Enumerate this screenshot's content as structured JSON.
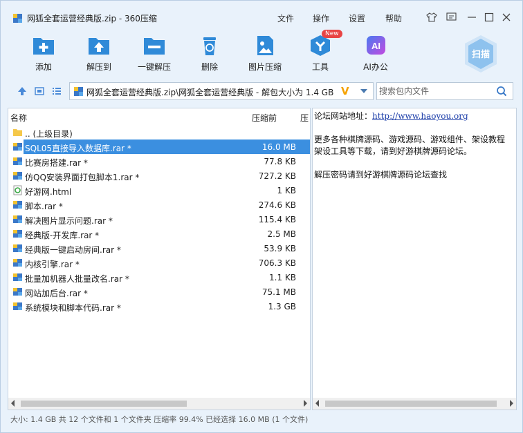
{
  "window": {
    "title": "网狐全套运营经典版.zip - 360压缩",
    "menu": [
      "文件",
      "操作",
      "设置",
      "帮助"
    ]
  },
  "toolbar": {
    "add": "添加",
    "extract_to": "解压到",
    "one_click": "一键解压",
    "delete": "删除",
    "image_compress": "图片压缩",
    "tools": "工具",
    "tools_badge": "New",
    "ai_office": "AI办公",
    "ai_icon": "AI",
    "scan": "扫描"
  },
  "address": {
    "path": "网狐全套运营经典版.zip\\网狐全套运营经典版 - 解包大小为 1.4 GB",
    "v_icon": "V"
  },
  "search": {
    "placeholder": "搜索包内文件"
  },
  "list": {
    "col_name": "名称",
    "col_compressed": "压缩前",
    "col_after": "压",
    "parent": ".. (上级目录)",
    "files": [
      {
        "name": "SQL05直接导入数据库.rar *",
        "size": "16.0 MB",
        "icon": "rar-icon",
        "selected": true
      },
      {
        "name": "比赛房搭建.rar *",
        "size": "77.8 KB",
        "icon": "rar-icon"
      },
      {
        "name": "仿QQ安装界面打包脚本1.rar *",
        "size": "727.2 KB",
        "icon": "rar-icon"
      },
      {
        "name": "好游网.html",
        "size": "1 KB",
        "icon": "html-icon"
      },
      {
        "name": "脚本.rar *",
        "size": "274.6 KB",
        "icon": "rar-icon"
      },
      {
        "name": "解决图片显示问题.rar *",
        "size": "115.4 KB",
        "icon": "rar-icon"
      },
      {
        "name": "经典版-开发库.rar *",
        "size": "2.5 MB",
        "icon": "rar-icon"
      },
      {
        "name": "经典版一键启动房间.rar *",
        "size": "53.9 KB",
        "icon": "rar-icon"
      },
      {
        "name": "内核引擎.rar *",
        "size": "706.3 KB",
        "icon": "rar-icon"
      },
      {
        "name": "批量加机器人批量改名.rar *",
        "size": "1.1 KB",
        "icon": "rar-icon"
      },
      {
        "name": "网站加后台.rar *",
        "size": "75.1 MB",
        "icon": "rar-icon"
      },
      {
        "name": "系统模块和脚本代码.rar *",
        "size": "1.3 GB",
        "icon": "rar-icon"
      }
    ]
  },
  "comment": {
    "site_label": "论坛网站地址：",
    "site_url": "http://www.haoyou.org",
    "line2": "更多各种棋牌源码、游戏源码、游戏组件、架设教程",
    "line3": "架设工具等下载，请到好游棋牌源码论坛。",
    "line4": "解压密码请到好游棋牌源码论坛查找"
  },
  "status": "大小: 1.4 GB 共 12 个文件和 1 个文件夹 压缩率 99.4% 已经选择 16.0 MB (1 个文件)",
  "colors": {
    "accent": "#2f8ad8",
    "selection": "#3b8fe0",
    "badge": "#e84444"
  }
}
